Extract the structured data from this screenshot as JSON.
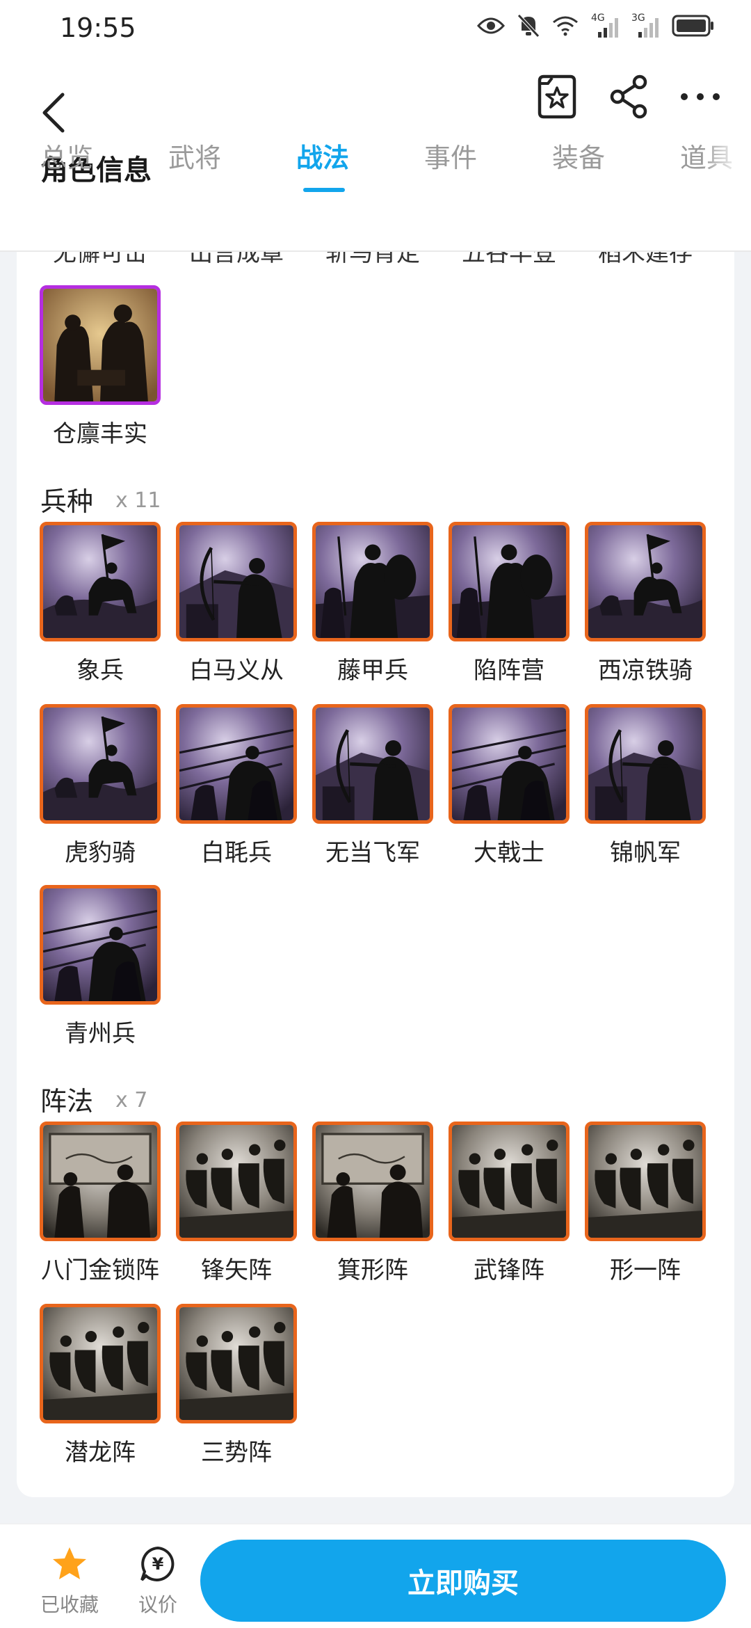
{
  "status_bar": {
    "time": "19:55",
    "network_1": "4G",
    "network_2": "3G"
  },
  "header": {
    "title": "角色信息",
    "icons": [
      "back-icon",
      "favorite-icon",
      "share-icon",
      "more-icon"
    ]
  },
  "tabs": [
    {
      "label": "总览",
      "active": false
    },
    {
      "label": "武将",
      "active": false
    },
    {
      "label": "战法",
      "active": true
    },
    {
      "label": "事件",
      "active": false
    },
    {
      "label": "装备",
      "active": false
    },
    {
      "label": "道具",
      "active": false
    }
  ],
  "cut_off_labels": [
    "无懈可击",
    "出言成章",
    "斩马肯定",
    "五谷丰登",
    "稻禾建存"
  ],
  "top_item": {
    "label": "仓廪丰实"
  },
  "sections": {
    "bingzhong": {
      "title": "兵种",
      "count": "x 11",
      "items": [
        "象兵",
        "白马义从",
        "藤甲兵",
        "陷阵营",
        "西凉铁骑",
        "虎豹骑",
        "白毦兵",
        "无当飞军",
        "大戟士",
        "锦帆军",
        "青州兵"
      ]
    },
    "zhenfa": {
      "title": "阵法",
      "count": "x 7",
      "items": [
        "八门金锁阵",
        "锋矢阵",
        "箕形阵",
        "武锋阵",
        "形一阵",
        "潜龙阵",
        "三势阵"
      ]
    }
  },
  "bottom_bar": {
    "fav_label": "已收藏",
    "price_label": "议价",
    "buy_label": "立即购买"
  },
  "colors": {
    "accent": "#12a5ec",
    "frame_orange": "#e8651c",
    "frame_purple": "#b52ee0",
    "star": "#ffa21a"
  }
}
